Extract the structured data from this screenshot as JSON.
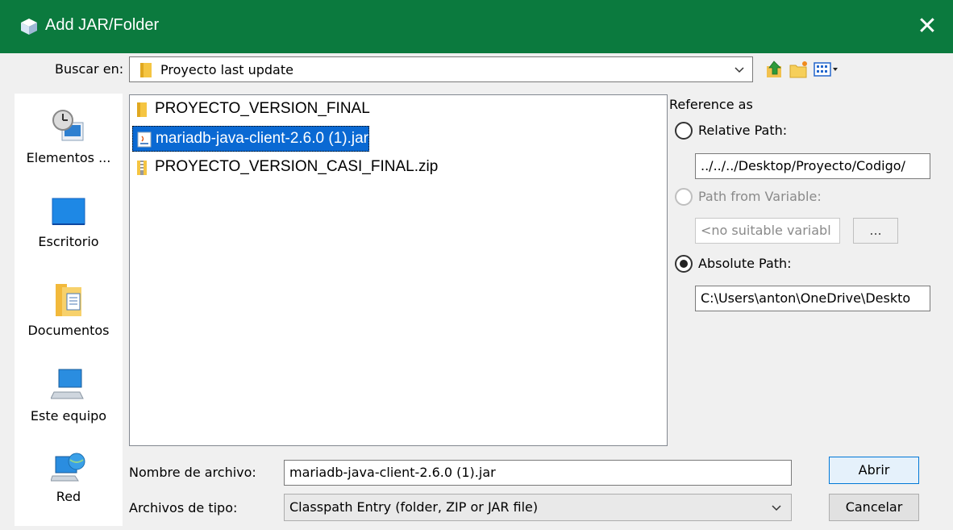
{
  "window": {
    "title": "Add JAR/Folder",
    "close_glyph": "✕"
  },
  "lookin": {
    "label": "Buscar en:",
    "value": "Proyecto last update"
  },
  "toolbar": {
    "icons": [
      "up-folder-icon",
      "new-folder-icon",
      "view-menu-icon"
    ]
  },
  "places": [
    {
      "label": "Elementos ...",
      "icon": "recent-items-icon"
    },
    {
      "label": "Escritorio",
      "icon": "desktop-icon"
    },
    {
      "label": "Documentos",
      "icon": "documents-icon"
    },
    {
      "label": "Este equipo",
      "icon": "computer-icon"
    },
    {
      "label": "Red",
      "icon": "network-icon"
    }
  ],
  "files": [
    {
      "name": "PROYECTO_VERSION_FINAL",
      "icon": "folder-icon",
      "selected": false
    },
    {
      "name": "mariadb-java-client-2.6.0 (1).jar",
      "icon": "jar-file-icon",
      "selected": true
    },
    {
      "name": "PROYECTO_VERSION_CASI_FINAL.zip",
      "icon": "zip-file-icon",
      "selected": false
    }
  ],
  "reference": {
    "title": "Reference as",
    "relative": {
      "label": "Relative Path:",
      "value": "../../../Desktop/Proyecto/Codigo/",
      "checked": false,
      "enabled": true
    },
    "variable": {
      "label": "Path from Variable:",
      "value": "<no suitable variabl",
      "button": "...",
      "checked": false,
      "enabled": false
    },
    "absolute": {
      "label": "Absolute Path:",
      "value": "C:\\Users\\anton\\OneDrive\\Deskto",
      "checked": true,
      "enabled": true
    }
  },
  "filename": {
    "label": "Nombre de archivo:",
    "value": "mariadb-java-client-2.6.0 (1).jar"
  },
  "filetype": {
    "label": "Archivos de tipo:",
    "value": "Classpath Entry (folder, ZIP or JAR file)"
  },
  "buttons": {
    "open": "Abrir",
    "cancel": "Cancelar"
  },
  "colors": {
    "titlebar": "#0b7a3e",
    "selection": "#0a69d3",
    "default_button_border": "#0078d7"
  }
}
